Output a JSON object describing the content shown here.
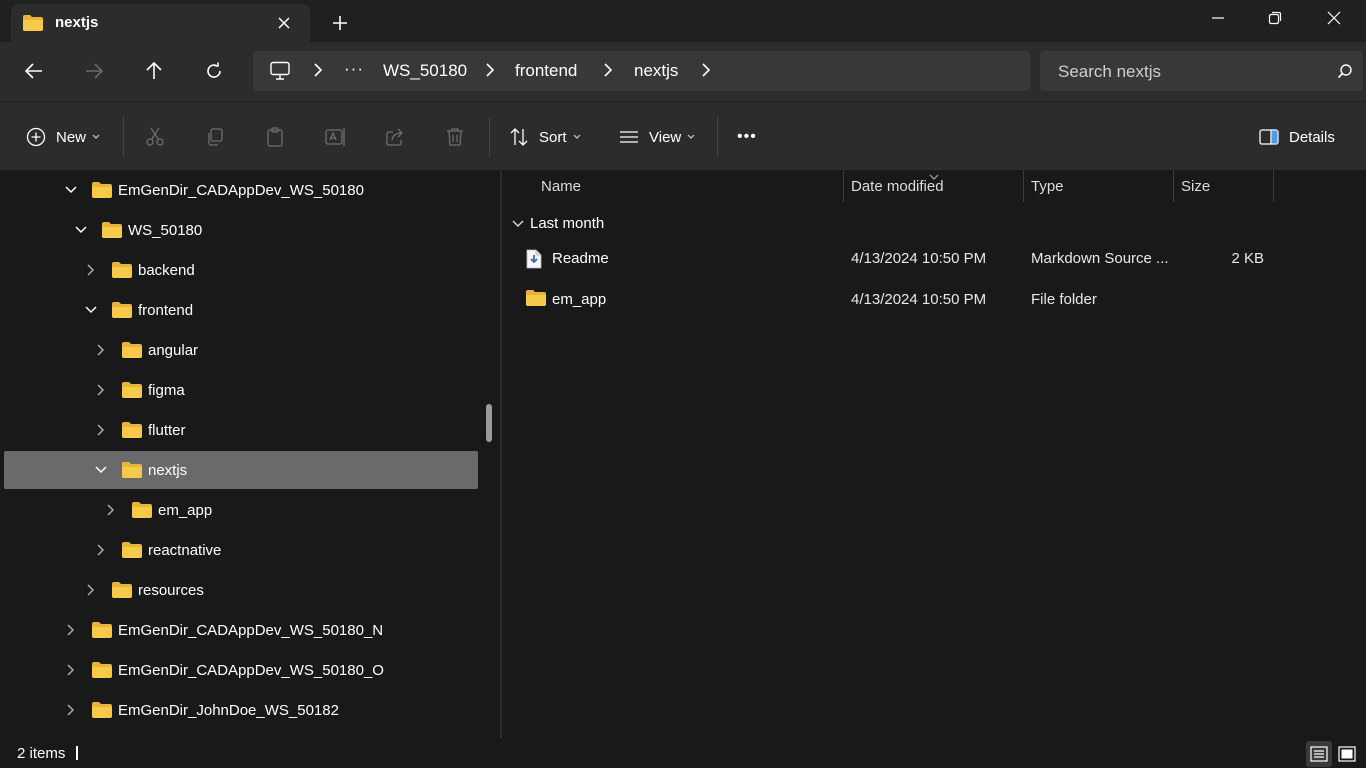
{
  "window": {
    "tab_title": "nextjs",
    "icons": {
      "minimize": "minimize-icon",
      "restore": "restore-icon",
      "close": "close-icon"
    }
  },
  "address_bar": {
    "segments": [
      "WS_50180",
      "frontend",
      "nextjs"
    ],
    "overflow": "···",
    "search_placeholder": "Search nextjs"
  },
  "toolbar": {
    "new_label": "New",
    "sort_label": "Sort",
    "view_label": "View",
    "more_label": "•••",
    "details_label": "Details"
  },
  "sidebar": {
    "items": [
      {
        "label": "EmGenDir_CADAppDev_WS_50180",
        "expanded": true
      },
      {
        "label": "WS_50180",
        "expanded": true
      },
      {
        "label": "backend",
        "expanded": false
      },
      {
        "label": "frontend",
        "expanded": true
      },
      {
        "label": "angular",
        "expanded": false
      },
      {
        "label": "figma",
        "expanded": false
      },
      {
        "label": "flutter",
        "expanded": false
      },
      {
        "label": "nextjs",
        "expanded": true,
        "selected": true
      },
      {
        "label": "em_app",
        "expanded": false
      },
      {
        "label": "reactnative",
        "expanded": false
      },
      {
        "label": "resources",
        "expanded": false
      },
      {
        "label": "EmGenDir_CADAppDev_WS_50180_N",
        "expanded": false
      },
      {
        "label": "EmGenDir_CADAppDev_WS_50180_O",
        "expanded": false
      },
      {
        "label": "EmGenDir_JohnDoe_WS_50182",
        "expanded": false
      }
    ]
  },
  "file_list": {
    "columns": {
      "name": "Name",
      "date": "Date modified",
      "type": "Type",
      "size": "Size"
    },
    "group_label": "Last month",
    "rows": [
      {
        "name": "Readme",
        "date": "4/13/2024 10:50 PM",
        "type": "Markdown Source ...",
        "size": "2 KB",
        "icon": "markdown-file-icon"
      },
      {
        "name": "em_app",
        "date": "4/13/2024 10:50 PM",
        "type": "File folder",
        "size": "",
        "icon": "folder-icon"
      }
    ]
  },
  "status": {
    "count": "2 items"
  },
  "colors": {
    "folder": "#F7C948",
    "selected_row": "#6A6A6A",
    "background": "#191919",
    "chrome": "#2C2C2C"
  }
}
